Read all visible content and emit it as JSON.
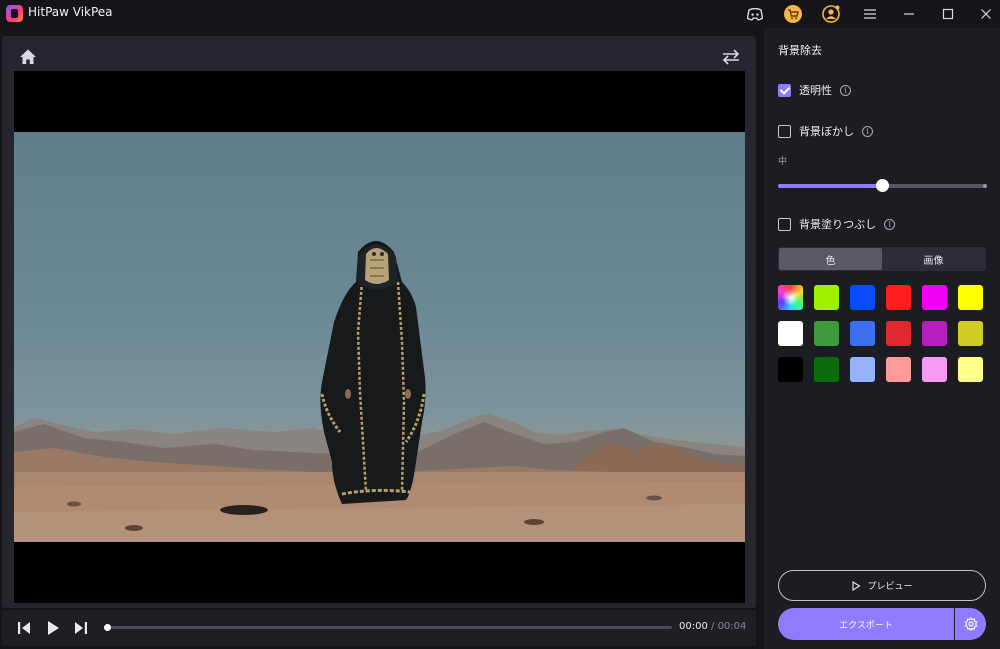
{
  "titlebar": {
    "title": "HitPaw VikPea",
    "icons": [
      "discord-icon",
      "cart-icon",
      "account-icon",
      "menu-icon",
      "minimize-icon",
      "maximize-icon",
      "close-icon"
    ]
  },
  "player": {
    "current_time": "00:00",
    "separator": " / ",
    "total_time": "00:04",
    "progress": 0
  },
  "panel": {
    "title": "背景除去",
    "transparency": {
      "label": "透明性",
      "checked": true
    },
    "blur": {
      "label": "背景ぼかし",
      "checked": false,
      "level_label": "中",
      "level": 0.5
    },
    "fill": {
      "label": "背景塗りつぶし",
      "checked": false
    },
    "tabs": [
      {
        "label": "色",
        "active": true
      },
      {
        "label": "画像",
        "active": false
      }
    ],
    "colors": [
      "rainbow",
      "#9ef100",
      "#0a4cff",
      "#ff1d1d",
      "#f400f4",
      "#ffff00",
      "#ffffff",
      "#3c9a3c",
      "#3d6ef0",
      "#e0282e",
      "#b51fbd",
      "#cfcc24",
      "#000000",
      "#0a6b0a",
      "#95b2ff",
      "#ff9b9b",
      "#f59bf5",
      "#ffff8a"
    ],
    "preview_label": "プレビュー",
    "export_label": "エクスポート"
  }
}
